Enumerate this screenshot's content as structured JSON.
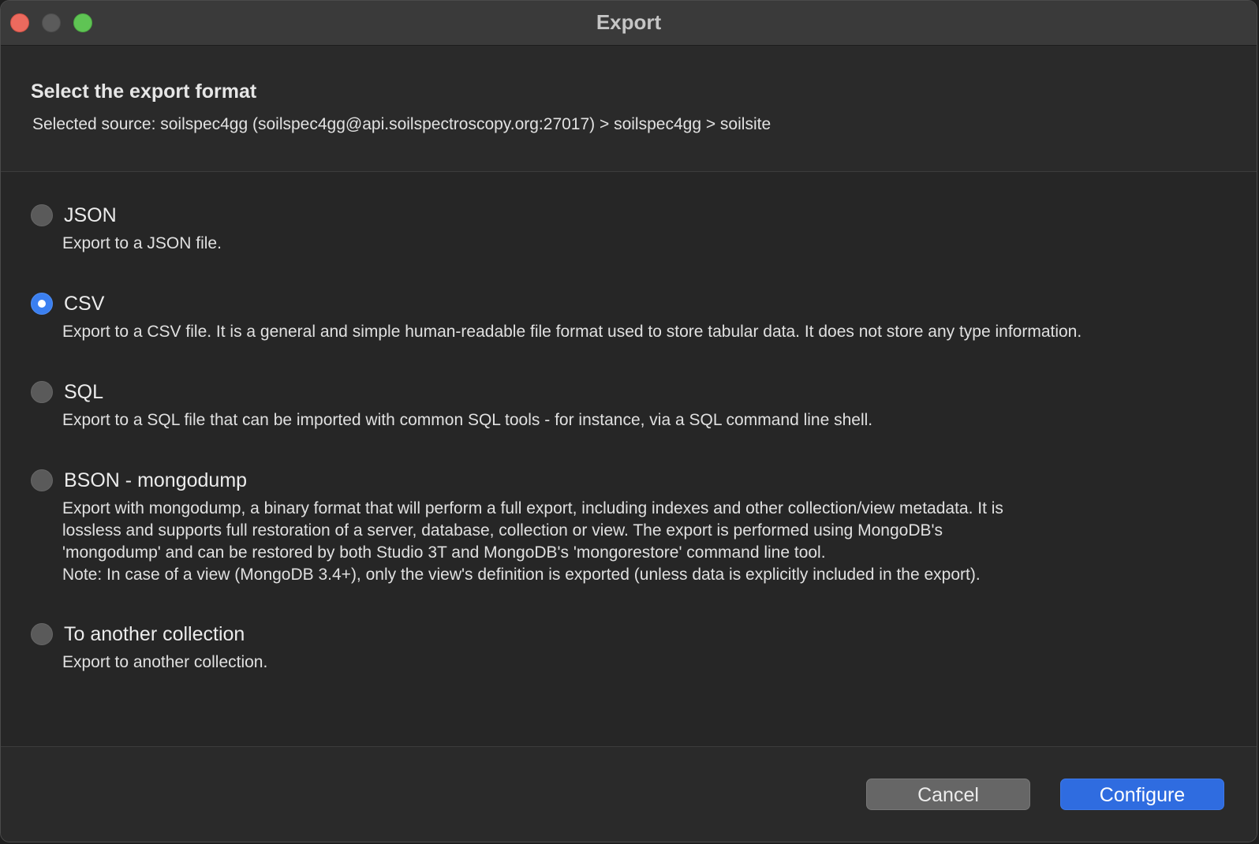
{
  "window": {
    "title": "Export"
  },
  "header": {
    "title": "Select the export format",
    "source": "Selected source: soilspec4gg (soilspec4gg@api.soilspectroscopy.org:27017) > soilspec4gg > soilsite"
  },
  "options": [
    {
      "label": "JSON",
      "checked": false,
      "desc": [
        "Export to a JSON file."
      ]
    },
    {
      "label": "CSV",
      "checked": true,
      "desc": [
        "Export to a CSV file. It is a general and simple human-readable file format used to store tabular data. It does not store any type information."
      ]
    },
    {
      "label": "SQL",
      "checked": false,
      "desc": [
        "Export to a SQL file that can be imported with common SQL tools - for instance, via a SQL command line shell."
      ]
    },
    {
      "label": "BSON - mongodump",
      "checked": false,
      "desc": [
        "Export with mongodump, a binary format that will perform a full export, including indexes and other collection/view metadata. It is",
        "lossless and supports full restoration of a server, database, collection or view. The export is performed using MongoDB's",
        "'mongodump' and can be restored by both Studio 3T and MongoDB's 'mongorestore' command line tool.",
        "Note: In case of a view (MongoDB 3.4+), only the view's definition is exported (unless data is explicitly included in the export)."
      ]
    },
    {
      "label": "To another collection",
      "checked": false,
      "desc": [
        "Export to another collection."
      ]
    }
  ],
  "footer": {
    "cancel_label": "Cancel",
    "configure_label": "Configure"
  },
  "colors": {
    "accent": "#2f6ce0",
    "radio_checked": "#3b7ff0",
    "close": "#ec6a5e",
    "maximize": "#5fc454"
  }
}
